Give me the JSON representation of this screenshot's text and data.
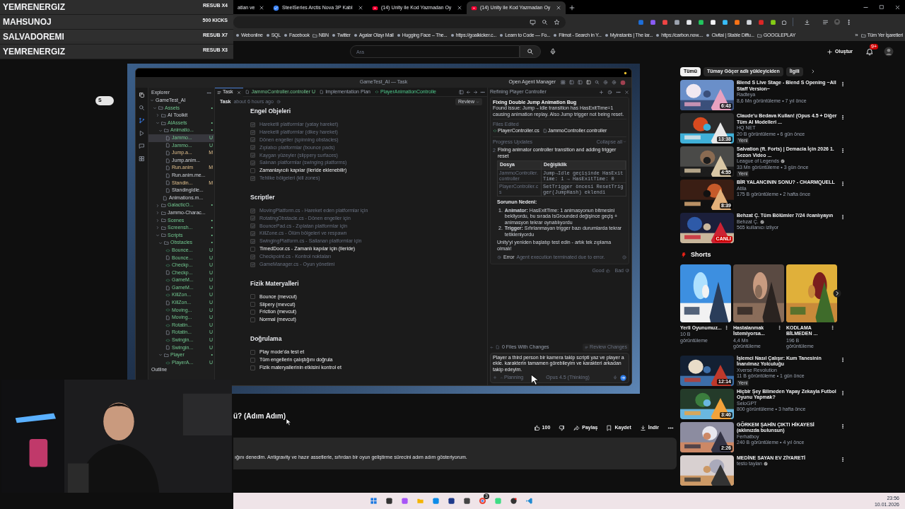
{
  "stream_alerts": [
    {
      "name": "YEMRENERGIZ",
      "event": "RESUB X4"
    },
    {
      "name": "MAHSUNOJ",
      "event": "500 KICKS"
    },
    {
      "name": "SALVADOREMI",
      "event": "RESUB X7"
    },
    {
      "name": "YEMRENERGIZ",
      "event": "RESUB X3"
    }
  ],
  "browser": {
    "tabs": [
      {
        "title": "atlan ve",
        "kind": "page",
        "selected": false
      },
      {
        "title": "SteelSeries Arctis Nova 3P Kabl",
        "kind": "check",
        "selected": false
      },
      {
        "title": "(14) Unity ile Kod Yazmadan Oy",
        "kind": "video",
        "selected": false
      },
      {
        "title": "(14) Unity ile Kod Yazmadan Oy",
        "kind": "video",
        "selected": true
      }
    ],
    "bookmarks": [
      {
        "label": "Webonline",
        "kind": "site"
      },
      {
        "label": "SQL",
        "kind": "site"
      },
      {
        "label": "Facebook",
        "kind": "site"
      },
      {
        "label": "NBN",
        "kind": "folder"
      },
      {
        "label": "Twitter",
        "kind": "site"
      },
      {
        "label": "Agalar Olayı Mail",
        "kind": "site"
      },
      {
        "label": "Hugging Face – The...",
        "kind": "site"
      },
      {
        "label": "https://goalkicker.c...",
        "kind": "site"
      },
      {
        "label": "Learn to Code — Fo...",
        "kind": "site"
      },
      {
        "label": "Filmot - Search in Y...",
        "kind": "site"
      },
      {
        "label": "Myinstants | The lar...",
        "kind": "site"
      },
      {
        "label": "https://carbon.now....",
        "kind": "site"
      },
      {
        "label": "Civitai | Stable Diffu...",
        "kind": "site"
      },
      {
        "label": "GOOGLEPLAY",
        "kind": "folder"
      }
    ],
    "more_bookmarks": "»",
    "all_bookmarks": "Tüm Yer İşaretleri"
  },
  "youtube_header": {
    "search_placeholder": "Ara",
    "create_label": "Oluştur",
    "notification_count": "9+"
  },
  "side_badge": "S",
  "ide": {
    "title": "GameTest_AI — Task",
    "agent_manager": "Open Agent Manager",
    "explorer_title": "Explorer",
    "tree": [
      {
        "label": "GameTest_AI",
        "kind": "folder",
        "expanded": true,
        "selected": false,
        "children": [
          {
            "label": "Assets",
            "kind": "folder",
            "expanded": true,
            "badge": "•",
            "selected": false,
            "children": [
              {
                "label": "AI Toolkit",
                "kind": "folder",
                "expanded": false,
                "selected": false
              },
              {
                "label": "AIAssets",
                "kind": "folder",
                "expanded": true,
                "badge": "•",
                "selected": false,
                "children": [
                  {
                    "label": "Animatio...",
                    "kind": "folder",
                    "expanded": true,
                    "badge": "•",
                    "selected": false,
                    "children": [
                      {
                        "label": "Jammo...",
                        "kind": "file",
                        "badge": "U",
                        "selected": true
                      },
                      {
                        "label": "Jammo...",
                        "kind": "file",
                        "badge": "U",
                        "selected": false
                      },
                      {
                        "label": "Jump.a...",
                        "kind": "file",
                        "badge": "M",
                        "selected": false
                      },
                      {
                        "label": "Jump.anim...",
                        "kind": "file",
                        "selected": false
                      },
                      {
                        "label": "Run.anim",
                        "kind": "file",
                        "badge": "M",
                        "selected": false
                      },
                      {
                        "label": "Run.anim.me...",
                        "kind": "file",
                        "selected": false
                      },
                      {
                        "label": "Standin...",
                        "kind": "file",
                        "badge": "M",
                        "selected": false
                      },
                      {
                        "label": "StandingIdle...",
                        "kind": "file",
                        "selected": false
                      }
                    ]
                  },
                  {
                    "label": "Animations.m...",
                    "kind": "file",
                    "selected": false
                  }
                ]
              },
              {
                "label": "GalacticO...",
                "kind": "folder",
                "expanded": false,
                "badge": "•",
                "selected": false
              },
              {
                "label": "Jammo-Charac...",
                "kind": "folder",
                "expanded": false,
                "selected": false
              },
              {
                "label": "Scenes",
                "kind": "folder",
                "expanded": false,
                "badge": "•",
                "selected": false
              },
              {
                "label": "Screensh...",
                "kind": "folder",
                "expanded": false,
                "badge": "•",
                "selected": false
              },
              {
                "label": "Scripts",
                "kind": "folder",
                "expanded": true,
                "badge": "•",
                "selected": false,
                "children": [
                  {
                    "label": "Obstacles",
                    "kind": "folder",
                    "expanded": true,
                    "badge": "•",
                    "selected": false,
                    "children": [
                      {
                        "label": "Bounce...",
                        "kind": "csharp",
                        "badge": "U",
                        "selected": false
                      },
                      {
                        "label": "Bounce...",
                        "kind": "file",
                        "badge": "U",
                        "selected": false
                      },
                      {
                        "label": "Checkp...",
                        "kind": "csharp",
                        "badge": "U",
                        "selected": false
                      },
                      {
                        "label": "Checkp...",
                        "kind": "file",
                        "badge": "U",
                        "selected": false
                      },
                      {
                        "label": "GameM...",
                        "kind": "csharp",
                        "badge": "U",
                        "selected": false
                      },
                      {
                        "label": "GameM...",
                        "kind": "file",
                        "badge": "U",
                        "selected": false
                      },
                      {
                        "label": "KillZon...",
                        "kind": "csharp",
                        "badge": "U",
                        "selected": false
                      },
                      {
                        "label": "KillZon...",
                        "kind": "file",
                        "badge": "U",
                        "selected": false
                      },
                      {
                        "label": "Moving...",
                        "kind": "csharp",
                        "badge": "U",
                        "selected": false
                      },
                      {
                        "label": "Moving...",
                        "kind": "file",
                        "badge": "U",
                        "selected": false
                      },
                      {
                        "label": "Rotatin...",
                        "kind": "csharp",
                        "badge": "U",
                        "selected": false
                      },
                      {
                        "label": "Rotatin...",
                        "kind": "file",
                        "badge": "U",
                        "selected": false
                      },
                      {
                        "label": "Swingin...",
                        "kind": "csharp",
                        "badge": "U",
                        "selected": false
                      },
                      {
                        "label": "Swingin...",
                        "kind": "file",
                        "badge": "U",
                        "selected": false
                      }
                    ]
                  },
                  {
                    "label": "Player",
                    "kind": "folder",
                    "expanded": true,
                    "badge": "•",
                    "selected": false,
                    "children": [
                      {
                        "label": "PlayerA...",
                        "kind": "csharp",
                        "badge": "U",
                        "selected": false
                      }
                    ]
                  }
                ]
              }
            ]
          }
        ]
      }
    ],
    "outline": "Outline",
    "editor_tabs": [
      {
        "label": "Task",
        "kind": "task",
        "selected": true
      },
      {
        "label": "JammoController.controller",
        "badge": "U",
        "kind": "file",
        "selected": false
      },
      {
        "label": "Implementation Plan",
        "kind": "file",
        "selected": false
      },
      {
        "label": "PlayerAnimationControlle",
        "kind": "csharp",
        "selected": false
      }
    ],
    "task_header": {
      "title": "Task",
      "time": "about 6 hours ago",
      "review": "Review"
    },
    "sections": [
      {
        "heading": "Engel Objeleri",
        "items": [
          {
            "text": "Hareketli platformlar (yatay hareket)",
            "checked": true
          },
          {
            "text": "Hareketli platformlar (dikey hareket)",
            "checked": true
          },
          {
            "text": "Dönen engeller (spinning obstacles)",
            "checked": true
          },
          {
            "text": "Zıplatıcı platformlar (bounce pads)",
            "checked": true
          },
          {
            "text": "Kaygan yüzeyler (slippery surfaces)",
            "checked": true
          },
          {
            "text": "Salınan platformlar (swinging platforms)",
            "checked": true
          },
          {
            "text": "Zamanlayıcılı kapılar (ileride eklenebilir)",
            "checked": false
          },
          {
            "text": "Tehlike bölgeleri (kill zones)",
            "checked": true
          }
        ]
      },
      {
        "heading": "Scriptler",
        "items": [
          {
            "text": "MovingPlatform.cs - Hareket eden platformlar için",
            "checked": true
          },
          {
            "text": "RotatingObstacle.cs - Dönen engeller için",
            "checked": true
          },
          {
            "text": "BouncePad.cs - Zıplatan platformlar için",
            "checked": true
          },
          {
            "text": "KillZone.cs - Ölüm bölgeleri ve respawn",
            "checked": true
          },
          {
            "text": "SwingingPlatform.cs - Sallanan platformlar için",
            "checked": true
          },
          {
            "text": "TimedDoor.cs - Zamanlı kapılar için (ileride)",
            "checked": false
          },
          {
            "text": "Checkpoint.cs - Kontrol noktaları",
            "checked": true
          },
          {
            "text": "GameManager.cs - Oyun yönetimi",
            "checked": true
          }
        ]
      },
      {
        "heading": "Fizik Materyalleri",
        "items": [
          {
            "text": "Bounce (mevcut)",
            "checked": false
          },
          {
            "text": "Slipery (mevcut)",
            "checked": false
          },
          {
            "text": "Friction (mevcut)",
            "checked": false
          },
          {
            "text": "Normal (mevcut)",
            "checked": false
          }
        ]
      },
      {
        "heading": "Doğrulama",
        "items": [
          {
            "text": "Play mode'da test et",
            "checked": false
          },
          {
            "text": "Tüm engellerin çalıştığını doğrula",
            "checked": false
          },
          {
            "text": "Fizik materyallerinin etkisini kontrol et",
            "checked": false
          }
        ]
      }
    ],
    "agent": {
      "title": "Refining Player Controller",
      "heading": "Fixing Double Jump Animation Bug",
      "summary": "Found issue: Jump→Idle transition has HasExitTime=1 causing animation replay. Also Jump trigger not being reset.",
      "files_label": "Files Edited",
      "files": [
        {
          "name": "PlayerController.cs",
          "kind": "csharp"
        },
        {
          "name": "JammoController.controller",
          "kind": "file"
        }
      ],
      "progress_label": "Progress Updates",
      "collapse": "Collapse all",
      "step_number": "2",
      "step_text": "Fixing animator controller transition and adding trigger reset",
      "table": {
        "columns": [
          "Dosya",
          "Değişiklik"
        ],
        "rows": [
          [
            "JammoController.controller",
            "Jump→Idle geçişinde HasExitTime: 1 → HasExitTime: 0"
          ],
          [
            "PlayerController.cs",
            "SetTrigger öncesi ResetTrigger(JumpHash) eklendi"
          ]
        ]
      },
      "cause_heading": "Sorunun Nedeni:",
      "causes": [
        {
          "number": "1.",
          "text": "**Animator:** HasExitTime: 1 animasyonun bitmesini bekliyordu, bu sırada IsGrounded değişince geçiş + animasyon tekrar oynatılıyordu"
        },
        {
          "number": "2.",
          "text": "**Trigger:** Sıfırlanmayan trigger bazı durumlarda tekrar tetikleniyordu"
        }
      ],
      "closing": "Unity'yi yeniden başlatıp test edin - artık tek zıplama olmalı!",
      "error_label": "Error",
      "error_text": "Agent execution terminated due to error.",
      "good": "Good",
      "bad": "Bad",
      "changes": "0 Files With Changes",
      "review_changes": "Review Changes",
      "input": "Player a third person bir kamera takip scripti yaz ve player a ekle. karakterin tamamen görebileyim ve karakteri arkadan takip edeyim.",
      "mode": "Planning",
      "model": "Opus 4.5 (Thinking)"
    }
  },
  "video_info": {
    "title": "ü? (Adım Adım)",
    "likes": "100",
    "share": "Paylaş",
    "save": "Kaydet",
    "download": "İndir",
    "description": "ığını denedim. Antigravity ve hazır assetlerle, sıfırdan bir oyun geliştirme sürecini adım adım gösteriyorum."
  },
  "sidebar": {
    "chips": [
      {
        "label": "Tümü",
        "selected": true
      },
      {
        "label": "Tümay Göçer adlı yükleyiciden",
        "selected": false
      },
      {
        "label": "İlgili",
        "selected": false
      }
    ],
    "videos": [
      {
        "title": "Blend S Live Stage - Blend S Opening ~All Staff Version~",
        "channel": "Radteya",
        "verified": false,
        "meta": "8,6 Mn görüntüleme • 7 yıl önce",
        "duration": "6:43"
      },
      {
        "title": "Claude'u Bedava Kullan! (Opus 4.5 + Diğer Tüm AI Modelleri ...",
        "channel": "HQ NET",
        "verified": false,
        "meta": "20 B görüntüleme • 6 gün önce",
        "duration": "13:38",
        "new_badge": "Yeni"
      },
      {
        "title": "Salvation (ft. Forts) | Demacia İçin 2026 1. Sezon Video ...",
        "channel": "League of Legends",
        "verified": true,
        "meta": "33 Mn görüntüleme • 3 gün önce",
        "duration": "4:55",
        "new_badge": "Yeni"
      },
      {
        "title": "BİR YALANCININ SONU? - CHARMQUELL",
        "channel": "Atila",
        "verified": false,
        "meta": "175 B görüntüleme • 2 hafta önce",
        "duration": "8:39"
      },
      {
        "title": "Behzat Ç. Tüm Bölümler 7/24 #canlıyayın",
        "channel": "Behzat Ç.",
        "verified": true,
        "meta": "565 kullanıcı izliyor",
        "live_badge": "CANLI"
      }
    ],
    "shorts_title": "Shorts",
    "shorts": [
      {
        "title": "Yerli Oyunumuz...",
        "views": "10 B görüntüleme"
      },
      {
        "title": "Hastalanmak İstemiyorsa...",
        "views": "4,4 Mn görüntüleme"
      },
      {
        "title": "KODLAMA BİLMEDEN ...",
        "views": "196 B görüntüleme"
      }
    ],
    "more_videos": [
      {
        "title": "İşlemci Nasıl Çalışır: Kum Tanesinin İnanılmaz Yolculuğu",
        "channel": "Xverse Revolution",
        "verified": false,
        "meta": "11 B görüntüleme • 1 gün önce",
        "duration": "12:14",
        "new_badge": "Yeni"
      },
      {
        "title": "Hiçbir Şey Bilmeden Yapay Zekayla Futbol Oyunu Yapmak?",
        "channel": "SeloGPT",
        "verified": false,
        "meta": "800 görüntüleme • 3 hafta önce",
        "duration": "3:40"
      },
      {
        "title": "GÖRKEM ŞAHİN ÇIKTI HİKAYESİ (aklınızda bulunsun)",
        "channel": "Ferhatboy",
        "verified": false,
        "meta": "240 B görüntüleme • 4 yıl önce",
        "duration": "2:26"
      },
      {
        "title": "MEDİNE SAYAN EV ZİYARETİ",
        "channel": "testo taylan",
        "verified": true
      }
    ]
  },
  "taskbar": {
    "badge": "3",
    "time": "23:56",
    "date": "10.01.2026"
  }
}
